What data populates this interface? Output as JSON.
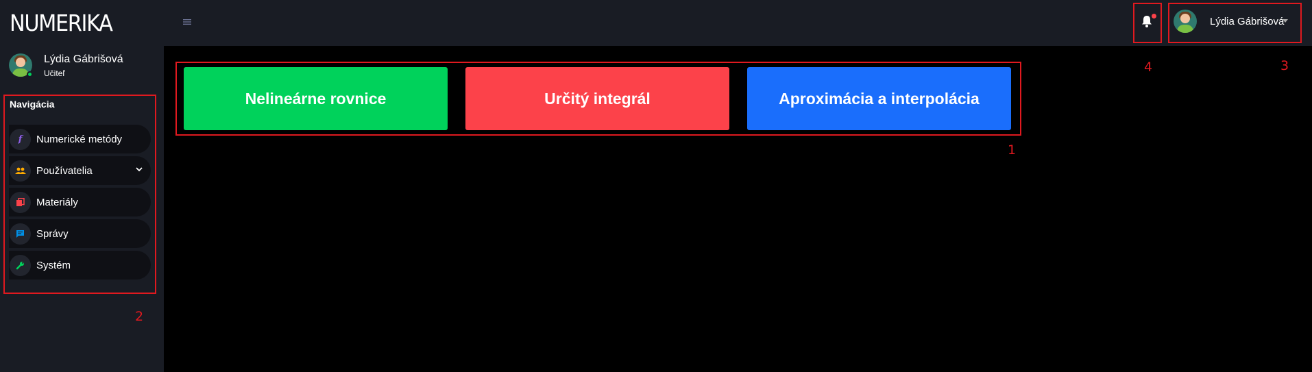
{
  "brand": {
    "name": "NUMERIKA"
  },
  "profile": {
    "name": "Lýdia Gábrišová",
    "role": "Učiteľ"
  },
  "navigation": {
    "heading": "Navigácia",
    "items": [
      {
        "label": "Numerické metódy",
        "icon": "function-icon",
        "glyph": "f",
        "color": "#8f5fe8"
      },
      {
        "label": "Používatelia",
        "icon": "users-icon",
        "glyph": "👥",
        "color": "#ffab00",
        "has_submenu": true
      },
      {
        "label": "Materiály",
        "icon": "book-icon",
        "glyph": "▮",
        "color": "#fc424a"
      },
      {
        "label": "Správy",
        "icon": "message-icon",
        "glyph": "▬",
        "color": "#0090e7"
      },
      {
        "label": "Systém",
        "icon": "wrench-icon",
        "glyph": "✎",
        "color": "#00d25b"
      }
    ]
  },
  "topbar": {
    "menu_icon": "hamburger-icon",
    "notifications_icon": "bell-icon",
    "has_unread": true,
    "user_name": "Lýdia Gábrišová"
  },
  "tiles": [
    {
      "label": "Nelineárne rovnice",
      "color": "#00d25b"
    },
    {
      "label": "Určitý integrál",
      "color": "#fc424a"
    },
    {
      "label": "Aproximácia a interpolácia",
      "color": "#1a6efc"
    }
  ],
  "annotations": {
    "markers": [
      "1",
      "2",
      "3",
      "4"
    ],
    "color": "#e0191f"
  }
}
